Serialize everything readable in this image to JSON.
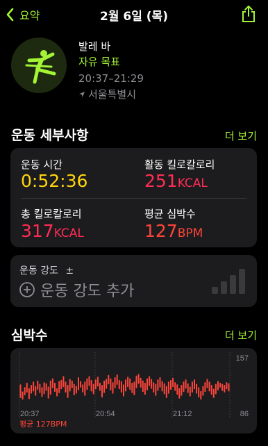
{
  "nav": {
    "back_label": "요약",
    "title": "2월 6일 (목)"
  },
  "workout": {
    "name": "발레 바",
    "goal": "자유 목표",
    "time_range": "20:37–21:29",
    "location": "서울특별시"
  },
  "details": {
    "title": "운동 세부사항",
    "more_label": "더 보기",
    "metrics": [
      {
        "label": "운동 시간",
        "value": "0:52:36",
        "unit": "",
        "color": "#ffd60a"
      },
      {
        "label": "활동 킬로칼로리",
        "value": "251",
        "unit": "KCAL",
        "color": "#ff2d55"
      },
      {
        "label": "총 킬로칼로리",
        "value": "317",
        "unit": "KCAL",
        "color": "#ff2d55"
      },
      {
        "label": "평균 심박수",
        "value": "127",
        "unit": "BPM",
        "color": "#ff453a"
      }
    ]
  },
  "effort": {
    "label": "운동 강도",
    "plus_minus": "±",
    "add_label": "운동 강도 추가"
  },
  "heart": {
    "title": "심박수",
    "more_label": "더 보기",
    "avg_label": "평균 127BPM"
  },
  "chart_data": {
    "type": "bar",
    "ylim": [
      86,
      157
    ],
    "y_ticks": [
      "157",
      "86"
    ],
    "x_ticks": [
      "20:37",
      "20:54",
      "21:12"
    ],
    "color": "#ff453a",
    "ranges": [
      [
        100,
        125
      ],
      [
        97,
        112
      ],
      [
        105,
        120
      ],
      [
        110,
        128
      ],
      [
        98,
        118
      ],
      [
        108,
        124
      ],
      [
        112,
        130
      ],
      [
        104,
        122
      ],
      [
        115,
        132
      ],
      [
        109,
        126
      ],
      [
        102,
        120
      ],
      [
        107,
        129
      ],
      [
        113,
        127
      ],
      [
        99,
        121
      ],
      [
        106,
        132
      ],
      [
        118,
        136
      ],
      [
        111,
        128
      ],
      [
        103,
        118
      ],
      [
        109,
        131
      ],
      [
        116,
        133
      ],
      [
        120,
        140
      ],
      [
        110,
        130
      ],
      [
        100,
        124
      ],
      [
        112,
        135
      ],
      [
        118,
        132
      ],
      [
        105,
        126
      ],
      [
        108,
        122
      ],
      [
        114,
        138
      ],
      [
        119,
        131
      ],
      [
        110,
        125
      ],
      [
        104,
        130
      ],
      [
        115,
        136
      ],
      [
        122,
        140
      ],
      [
        112,
        133
      ],
      [
        107,
        126
      ],
      [
        116,
        134
      ],
      [
        121,
        139
      ],
      [
        113,
        128
      ],
      [
        101,
        124
      ],
      [
        109,
        132
      ],
      [
        117,
        135
      ],
      [
        125,
        142
      ],
      [
        114,
        136
      ],
      [
        108,
        129
      ],
      [
        118,
        138
      ],
      [
        124,
        143
      ],
      [
        116,
        133
      ],
      [
        110,
        131
      ],
      [
        103,
        125
      ],
      [
        112,
        134
      ],
      [
        120,
        139
      ],
      [
        115,
        136
      ],
      [
        109,
        128
      ],
      [
        105,
        130
      ],
      [
        118,
        141
      ],
      [
        126,
        144
      ],
      [
        119,
        137
      ],
      [
        111,
        132
      ],
      [
        106,
        128
      ],
      [
        114,
        136
      ],
      [
        122,
        140
      ],
      [
        117,
        135
      ],
      [
        110,
        129
      ],
      [
        104,
        126
      ],
      [
        113,
        134
      ],
      [
        119,
        138
      ],
      [
        112,
        131
      ],
      [
        107,
        127
      ],
      [
        100,
        122
      ],
      [
        108,
        130
      ],
      [
        115,
        133
      ],
      [
        120,
        137
      ],
      [
        113,
        129
      ],
      [
        106,
        125
      ],
      [
        99,
        118
      ],
      [
        104,
        124
      ],
      [
        111,
        130
      ],
      [
        117,
        134
      ],
      [
        109,
        127
      ],
      [
        103,
        121
      ],
      [
        110,
        130
      ],
      [
        116,
        134
      ],
      [
        108,
        126
      ],
      [
        101,
        120
      ],
      [
        97,
        113
      ],
      [
        104,
        122
      ],
      [
        111,
        129
      ],
      [
        118,
        135
      ],
      [
        112,
        130
      ],
      [
        106,
        124
      ],
      [
        100,
        117
      ],
      [
        107,
        126
      ],
      [
        114,
        131
      ],
      [
        119,
        128
      ],
      [
        113,
        126
      ],
      [
        110,
        124
      ],
      [
        116,
        129
      ],
      [
        112,
        127
      ]
    ]
  }
}
